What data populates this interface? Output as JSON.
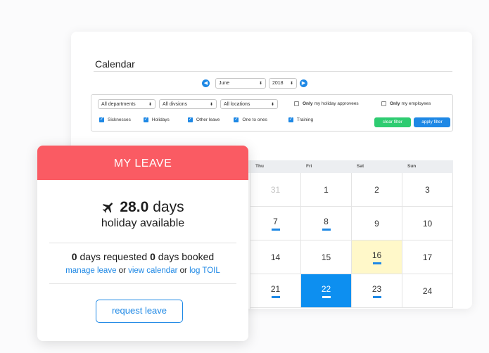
{
  "calendar": {
    "title": "Calendar",
    "month": "June",
    "year": "2018",
    "prev_icon": "chevron-left-icon",
    "next_icon": "chevron-right-icon",
    "filters": {
      "departments": "All departments",
      "divisions": "All divsions",
      "locations": "All locations",
      "holiday_approvees_bold": "Only",
      "holiday_approvees_rest": "my holiday approvees",
      "holiday_approvees_checked": false,
      "employees_bold": "Only",
      "employees_rest": "my employees",
      "employees_checked": false,
      "types": [
        {
          "label": "Sicknesses",
          "checked": true
        },
        {
          "label": "Holidays",
          "checked": true
        },
        {
          "label": "Other leave",
          "checked": true
        },
        {
          "label": "One to ones",
          "checked": true
        },
        {
          "label": "Training",
          "checked": true
        }
      ],
      "clear_label": "clear filter",
      "apply_label": "apply filter"
    },
    "day_headers": [
      "Thu",
      "Fri",
      "Sat",
      "Sun"
    ],
    "rows": [
      [
        {
          "n": "31",
          "dim": true
        },
        {
          "n": "1"
        },
        {
          "n": "2"
        },
        {
          "n": "3"
        }
      ],
      [
        {
          "n": "7",
          "bar": true
        },
        {
          "n": "8",
          "bar": true
        },
        {
          "n": "9"
        },
        {
          "n": "10"
        }
      ],
      [
        {
          "n": "14"
        },
        {
          "n": "15"
        },
        {
          "n": "16",
          "bar": true,
          "highlight": "yellow"
        },
        {
          "n": "17"
        }
      ],
      [
        {
          "n": "21",
          "bar": true
        },
        {
          "n": "22",
          "bar": true,
          "highlight": "blue"
        },
        {
          "n": "23",
          "bar": true
        },
        {
          "n": "24"
        }
      ]
    ],
    "colors": {
      "accent": "#1e88e5",
      "today": "#0d8ff0",
      "highlight": "#fff8c9",
      "clear": "#2ecc71"
    }
  },
  "leave": {
    "title": "MY LEAVE",
    "icon": "airplane-icon",
    "days_value": "28.0",
    "days_unit": "days",
    "available_label": "holiday available",
    "requested_value": "0",
    "requested_label": "days requested",
    "booked_value": "0",
    "booked_label": "days booked",
    "link_manage": "manage leave",
    "link_or1": "or",
    "link_calendar": "view calendar",
    "link_or2": "or",
    "link_toil": "log TOIL",
    "request_button": "request leave",
    "colors": {
      "header": "#fa5b63"
    }
  }
}
